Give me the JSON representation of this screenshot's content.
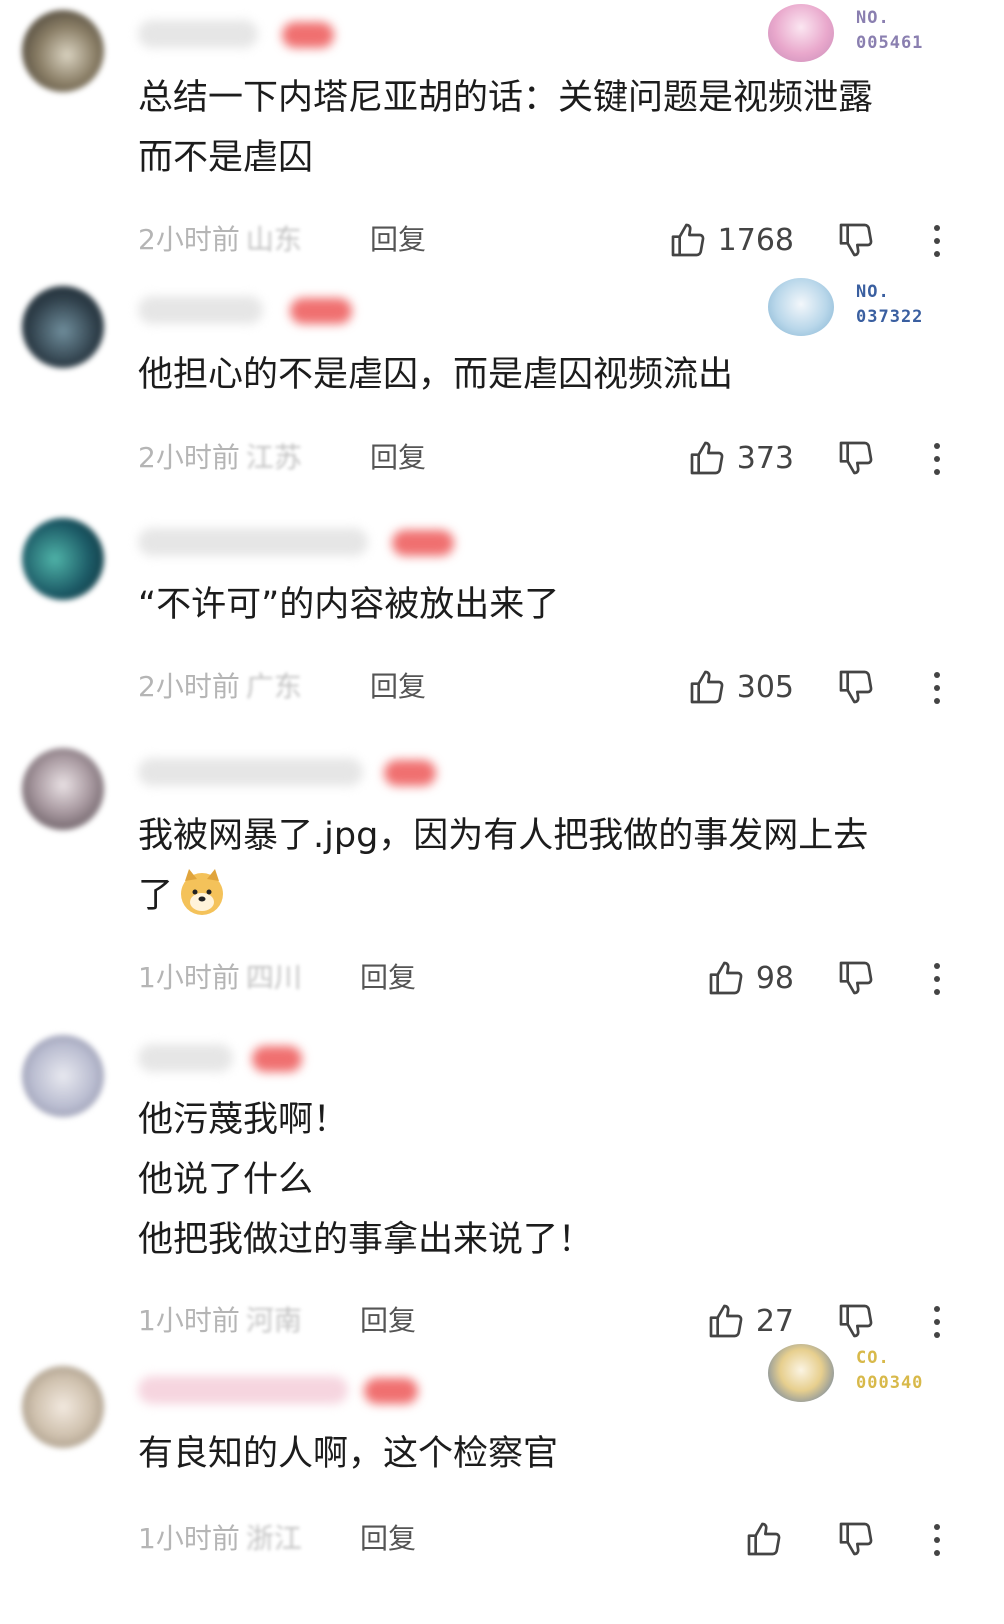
{
  "comments": [
    {
      "text_lines": [
        "总结一下内塔尼亚胡的话：关键问题是视频泄露",
        "而不是虐囚"
      ],
      "time": "2小时前",
      "location": "山东",
      "reply_label": "回复",
      "likes": "1768",
      "fan_badge": {
        "line1": "NO.",
        "line2": "005461",
        "color": "#8a7fb0"
      }
    },
    {
      "text_lines": [
        "他担心的不是虐囚，而是虐囚视频流出"
      ],
      "time": "2小时前",
      "location": "江苏",
      "reply_label": "回复",
      "likes": "373",
      "fan_badge": {
        "line1": "NO.",
        "line2": "037322",
        "color": "#3a5fa0"
      }
    },
    {
      "text_lines": [
        "“不许可”的内容被放出来了"
      ],
      "time": "2小时前",
      "location": "广东",
      "reply_label": "回复",
      "likes": "305"
    },
    {
      "text_lines": [
        "我被网暴了.jpg，因为有人把我做的事发网上去",
        "了"
      ],
      "time": "1小时前",
      "location": "四川",
      "reply_label": "回复",
      "likes": "98",
      "emoji": "doge-emoji"
    },
    {
      "text_lines": [
        "他污蔑我啊！",
        "他说了什么",
        "他把我做过的事拿出来说了！"
      ],
      "time": "1小时前",
      "location": "河南",
      "reply_label": "回复",
      "likes": "27"
    },
    {
      "text_lines": [
        "有良知的人啊，这个检察官"
      ],
      "time": "1小时前",
      "location": "浙江",
      "reply_label": "回复",
      "likes": "",
      "fan_badge": {
        "line1": "CO.",
        "line2": "000340",
        "color": "#d8b94a"
      }
    }
  ],
  "icons": {
    "like": "thumbs-up-icon",
    "dislike": "thumbs-down-icon",
    "more": "more-vertical-icon"
  }
}
